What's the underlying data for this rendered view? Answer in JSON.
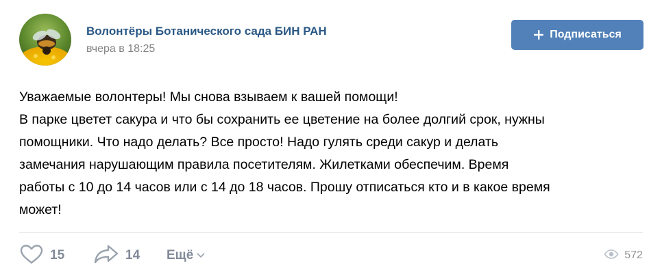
{
  "post": {
    "group_name": "Волонтёры Ботанического сада БИН РАН",
    "time": "вчера в 18:25",
    "subscribe_label": "Подписаться",
    "text_lines": [
      "Уважаемые волонтеры! Мы снова взываем к вашей помощи!",
      "В парке цветет сакура и что бы сохранить ее цветение на более долгий срок, нужны",
      "помощники. Что надо делать? Все просто! Надо гулять среди сакур и делать",
      "замечания нарушающим правила посетителям. Жилетками обеспечим. Время",
      "работы с 10 до 14 часов или с 14 до 18 часов. Прошу отписаться кто и в какое время",
      "может!"
    ]
  },
  "footer": {
    "likes": "15",
    "shares": "14",
    "more_label": "Ещё",
    "views": "572"
  },
  "icons": {
    "avatar": "bee-on-flower-image",
    "subscribe": "plus-icon",
    "like": "heart-icon",
    "share": "share-arrow-icon",
    "more": "chevron-down-icon",
    "views": "eye-icon"
  },
  "colors": {
    "accent": "#5181b8",
    "link": "#2a5885",
    "muted": "#828282",
    "action": "#828a99"
  }
}
